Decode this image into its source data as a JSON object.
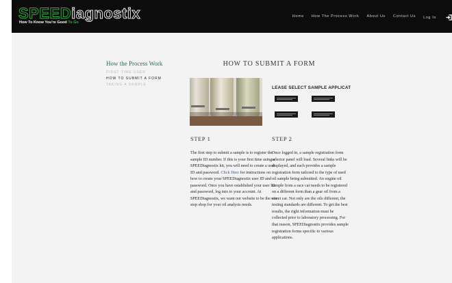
{
  "header": {
    "logo_speed": "SPEED",
    "logo_diag": "iagnostix",
    "tagline_main": "How To Know You're Good",
    "tagline_accent": "To Go",
    "nav": [
      "Home",
      "How The Process Work",
      "About Us",
      "Contact Us"
    ],
    "login_label": "Log In"
  },
  "sidebar": {
    "title": "How the Process Work",
    "items": [
      {
        "label": "FIRST TIME USER",
        "active": false
      },
      {
        "label": "HOW TO SUBMIT A FORM",
        "active": true
      },
      {
        "label": "TAKING A SAMPLE",
        "active": false
      }
    ]
  },
  "main": {
    "title": "HOW TO SUBMIT A FORM",
    "select_title": "LEASE SELECT SAMPLE APPLICATIC",
    "step1": {
      "title": "STEP 1",
      "text_before_link": "The first step to submit a sample is to register the sample ID number. If this is your first time using a SPEEDiagnostix kit, you will need to create a user ID and password. ",
      "link": "Click Here",
      "text_after_link": " for instructions on how to create your SPEEDiagnostix user ID and password. Once you have established your user ID and password, log into to your account. At SPEEDiagnostix, we want our website to be the one stop shop for your oil analysis needs."
    },
    "step2": {
      "title": "STEP 2",
      "text": "Once logged in, a sample registration form selector panel will load. Several links will be displayed, and each provides a sample registration form tailored to the type of used oil sample being submitted. An engine oil sample from a race car needs to be registered on a different form than a gear oil from a street car. Not only are the oils different, the testing standards are different. To get the best results, the right information must be collected prior to laboratory processing. For that reason, SPEEDiagnostix provides sample registration forms specific to various applications."
    }
  },
  "colors": {
    "header_bg": "#0c0c0c",
    "brand_green": "#2fae3c",
    "sidebar_title": "#2d6e47",
    "link": "#3a55a6"
  },
  "icons": {
    "login": "login-arrow-icon"
  }
}
